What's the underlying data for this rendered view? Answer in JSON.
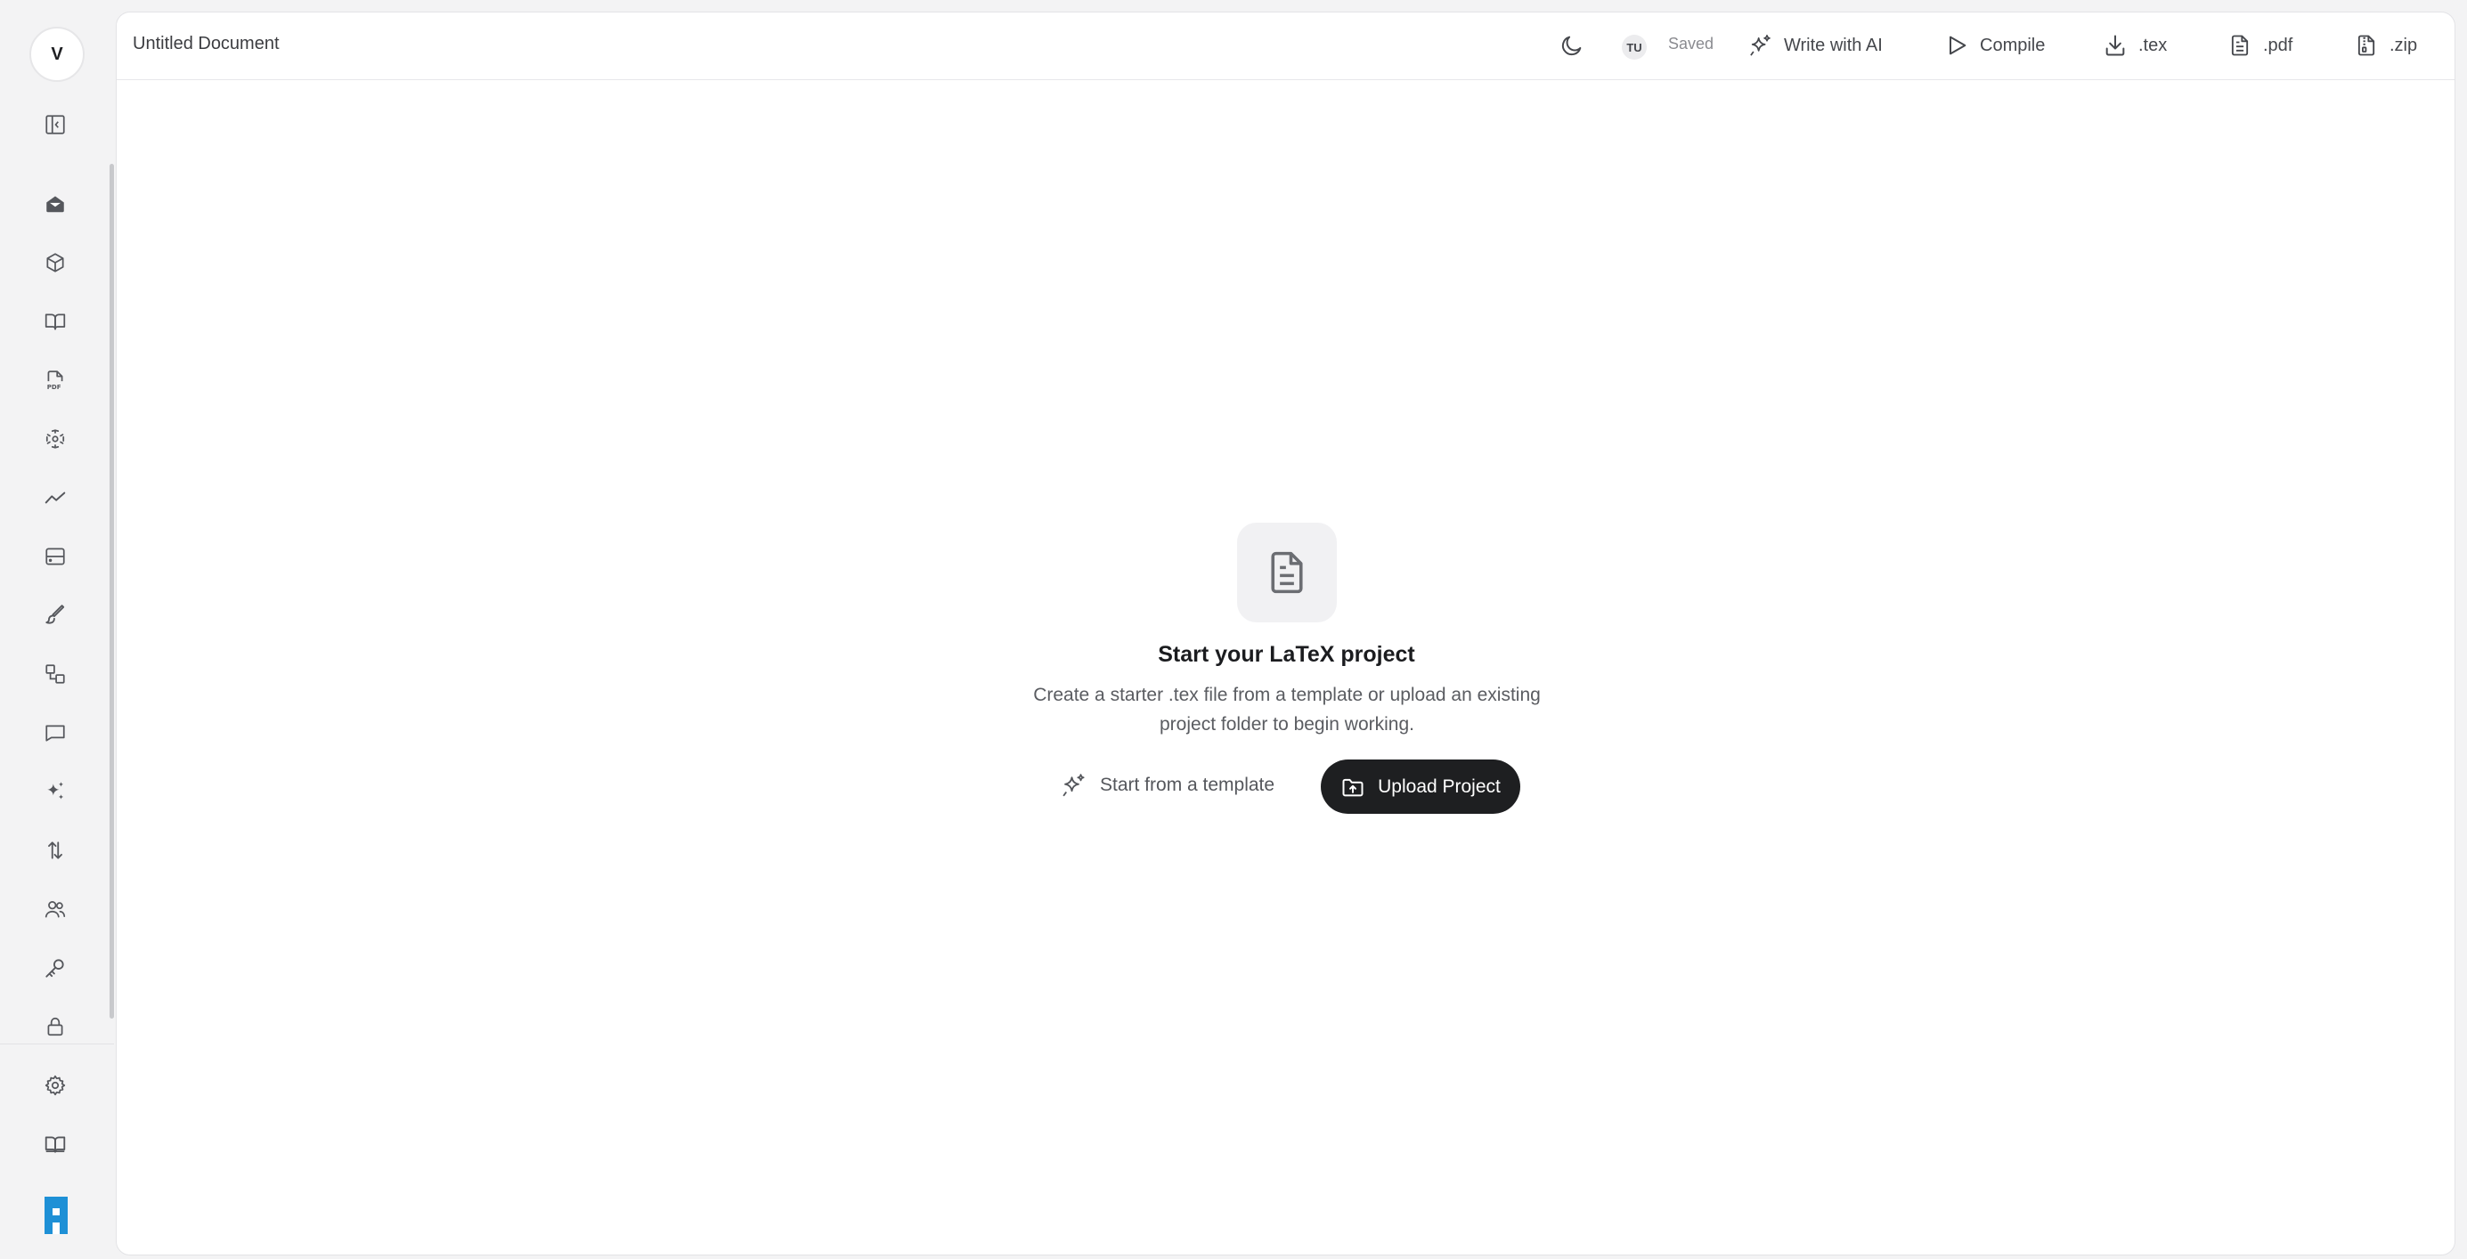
{
  "sidebar": {
    "avatar_initial": "V",
    "items": [
      {
        "name": "sidebar-toggle",
        "icon": "panel-left-icon"
      },
      {
        "name": "home",
        "icon": "inbox-icon"
      },
      {
        "name": "packages",
        "icon": "cube-icon"
      },
      {
        "name": "library",
        "icon": "book-open-icon"
      },
      {
        "name": "pdf",
        "icon": "pdf-file-icon"
      },
      {
        "name": "nodes",
        "icon": "network-icon"
      },
      {
        "name": "analytics",
        "icon": "trend-icon"
      },
      {
        "name": "storage",
        "icon": "server-icon"
      },
      {
        "name": "draw",
        "icon": "brush-icon"
      },
      {
        "name": "shapes",
        "icon": "shapes-icon"
      },
      {
        "name": "comments",
        "icon": "chat-icon"
      },
      {
        "name": "ai",
        "icon": "sparkles-icon"
      },
      {
        "name": "sort",
        "icon": "arrows-updown-icon"
      },
      {
        "name": "users",
        "icon": "users-icon"
      },
      {
        "name": "keys",
        "icon": "key-icon"
      },
      {
        "name": "security",
        "icon": "lock-icon"
      },
      {
        "name": "settings",
        "icon": "gear-icon"
      },
      {
        "name": "docs",
        "icon": "book-icon"
      }
    ]
  },
  "header": {
    "doc_title": "Untitled Document",
    "user_initials": "TU",
    "save_status": "Saved",
    "write_ai_label": "Write with AI",
    "compile_label": "Compile",
    "tex_label": ".tex",
    "pdf_label": ".pdf",
    "zip_label": ".zip"
  },
  "empty_state": {
    "title": "Start your LaTeX project",
    "description": "Create a starter .tex file from a template or upload an existing project folder to begin working.",
    "template_button": "Start from a template",
    "upload_button": "Upload Project"
  },
  "colors": {
    "accent_dark": "#1e1f21",
    "brand_blue": "#1e90d6"
  }
}
